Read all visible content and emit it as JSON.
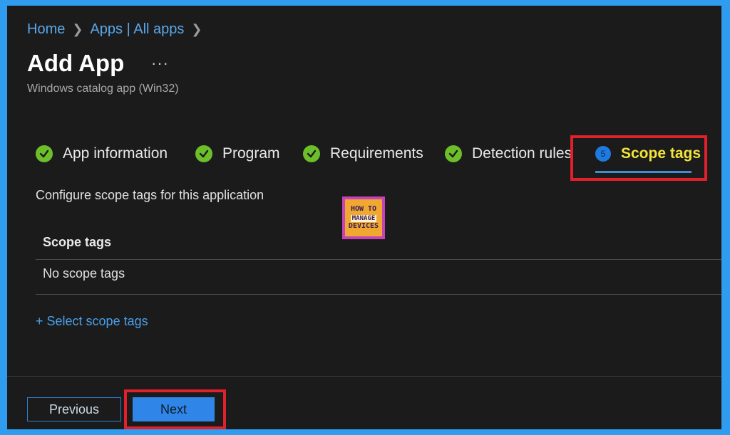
{
  "breadcrumb": {
    "items": [
      "Home",
      "Apps | All apps"
    ]
  },
  "header": {
    "title": "Add App",
    "more": "···",
    "subtitle": "Windows catalog app (Win32)"
  },
  "steps": [
    {
      "label": "App information",
      "state": "done"
    },
    {
      "label": "Program",
      "state": "done"
    },
    {
      "label": "Requirements",
      "state": "done"
    },
    {
      "label": "Detection rules",
      "state": "done"
    },
    {
      "label": "Scope tags",
      "state": "active",
      "number": "5"
    }
  ],
  "main": {
    "description": "Configure scope tags for this application",
    "table_header": "Scope tags",
    "empty_row": "No scope tags",
    "select_link": "+ Select scope tags"
  },
  "watermark": {
    "line1": "HOW TO",
    "line2": "MANAGE",
    "line3": "DEVICES"
  },
  "footer": {
    "previous_label": "Previous",
    "next_label": "Next"
  },
  "colors": {
    "background": "#1b1b1b",
    "border": "#2f9cf0",
    "check": "#6cbf2a",
    "active_text": "#f3e43a",
    "link": "#4aa0ea",
    "highlight": "#e0202a",
    "primary_button": "#2f86e8"
  },
  "icons": {
    "done": "check-circle-icon",
    "breadcrumb_separator": "chevron-right-icon"
  }
}
